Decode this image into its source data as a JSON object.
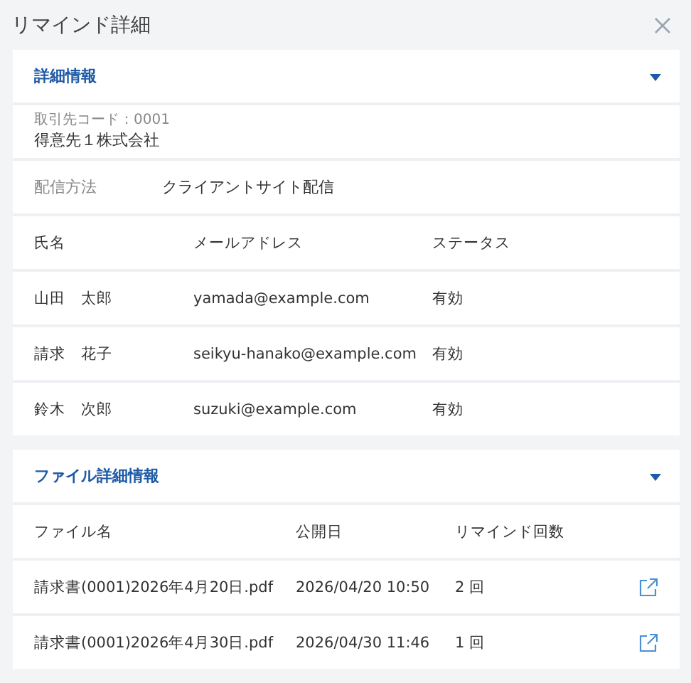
{
  "window": {
    "title": "リマインド詳細"
  },
  "sections": [
    {
      "kind": "details",
      "title": "詳細情報",
      "expanded": true,
      "client": {
        "caption": "取引先コード：0001",
        "name": "得意先１株式会社"
      },
      "delivery": {
        "label": "配信方法",
        "value": "クライアントサイト配信"
      },
      "columns": [
        "氏名",
        "メールアドレス",
        "ステータス"
      ],
      "rows": [
        {
          "cells": [
            "山田　太郎",
            "yamada@example.com",
            "有効"
          ]
        },
        {
          "cells": [
            "請求　花子",
            "seikyu-hanako@example.com",
            "有効"
          ]
        },
        {
          "cells": [
            "鈴木　次郎",
            "suzuki@example.com",
            "有効"
          ]
        }
      ]
    },
    {
      "kind": "files",
      "title": "ファイル詳細情報",
      "expanded": true,
      "columns": [
        "ファイル名",
        "公開日",
        "リマインド回数"
      ],
      "rows": [
        {
          "cells": [
            "請求書(0001)2026年4月20日.pdf",
            "2026/04/20 10:50",
            "2 回"
          ]
        },
        {
          "cells": [
            "請求書(0001)2026年4月30日.pdf",
            "2026/04/30 11:46",
            "1 回"
          ]
        }
      ]
    }
  ]
}
